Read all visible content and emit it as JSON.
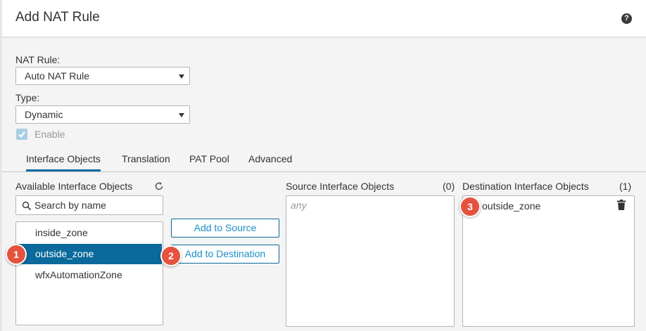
{
  "dialog": {
    "title": "Add NAT Rule",
    "help_icon": "?"
  },
  "form": {
    "nat_rule_label": "NAT Rule:",
    "nat_rule_value": "Auto NAT Rule",
    "type_label": "Type:",
    "type_value": "Dynamic",
    "enable_label": "Enable",
    "enable_checked": true
  },
  "tabs": [
    {
      "label": "Interface Objects",
      "active": true
    },
    {
      "label": "Translation",
      "active": false
    },
    {
      "label": "PAT Pool",
      "active": false
    },
    {
      "label": "Advanced",
      "active": false
    }
  ],
  "available": {
    "title": "Available Interface Objects",
    "search_placeholder": "Search by name",
    "items": [
      "inside_zone",
      "outside_zone",
      "wfxAutomationZone"
    ],
    "selected_index": 1
  },
  "buttons": {
    "add_to_source": "Add to Source",
    "add_to_destination": "Add to Destination"
  },
  "source": {
    "title": "Source Interface Objects",
    "count": "(0)",
    "placeholder": "any"
  },
  "destination": {
    "title": "Destination Interface Objects",
    "count": "(1)",
    "items": [
      "outside_zone"
    ]
  },
  "callouts": [
    "1",
    "2",
    "3"
  ],
  "colors": {
    "accent": "#0a6a9c",
    "link": "#1a8fc7",
    "callout": "#e5533f"
  },
  "icons": {
    "help": "help-icon",
    "refresh": "refresh-icon",
    "search": "search-icon",
    "trash": "trash-icon",
    "check": "check-icon",
    "caret": "chevron-down-icon"
  }
}
